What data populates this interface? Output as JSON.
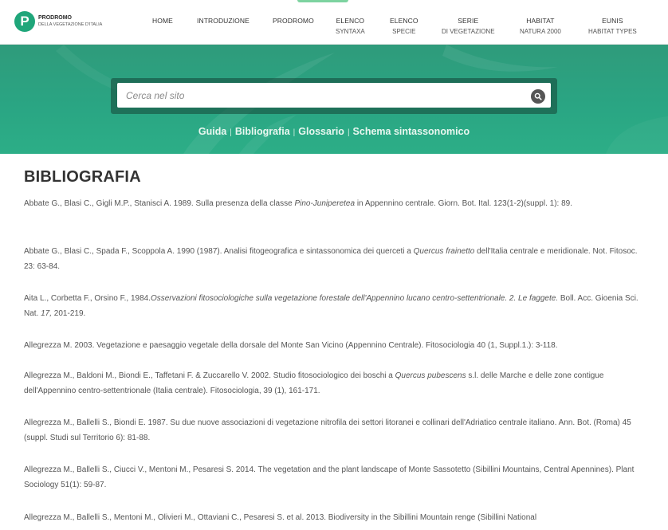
{
  "logo": {
    "letter": "P",
    "title": "PRODROMO",
    "subtitle": "DELLA VEGETAZIONE D'ITALIA"
  },
  "nav": [
    {
      "main": "HOME",
      "sub": ""
    },
    {
      "main": "INTRODUZIONE",
      "sub": ""
    },
    {
      "main": "PRODROMO",
      "sub": ""
    },
    {
      "main": "ELENCO",
      "sub": "SYNTAXA"
    },
    {
      "main": "ELENCO",
      "sub": "SPECIE"
    },
    {
      "main": "SERIE",
      "sub": "DI VEGETAZIONE"
    },
    {
      "main": "HABITAT",
      "sub": "NATURA 2000"
    },
    {
      "main": "EUNIS",
      "sub": "HABITAT TYPES"
    }
  ],
  "search": {
    "placeholder": "Cerca nel sito",
    "value": ""
  },
  "hero_links": [
    "Guida",
    "Bibliografia",
    "Glossario",
    "Schema sintassonomico"
  ],
  "hero_separator": "|",
  "page_title": "BIBLIOGRAFIA",
  "references": [
    [
      {
        "text": "Abbate G., Blasi C., Gigli M.P., Stanisci A. 1989. Sulla presenza della classe "
      },
      {
        "text": "Pino-Juniperetea",
        "italic": true
      },
      {
        "text": " in Appennino centrale. Giorn. Bot. Ital. 123(1-2)(suppl. 1): 89."
      }
    ],
    [
      {
        "text": "Abbate G., Blasi C., Spada F., Scoppola A. 1990 (1987). Analisi fitogeografica e sintassonomica dei querceti a "
      },
      {
        "text": "Quercus frainetto",
        "italic": true
      },
      {
        "text": " dell'Italia centrale e meridionale. Not. Fitosoc. 23: 63-84."
      }
    ],
    [
      {
        "text": "Aita L., Corbetta F., Orsino F., 1984."
      },
      {
        "text": "Osservazioni fitosociologiche sulla vegetazione forestale dell'Appennino lucano centro-settentrionale. 2. Le faggete.",
        "italic": true
      },
      {
        "text": " Boll. Acc. Gioenia Sci. Nat. "
      },
      {
        "text": "17,",
        "italic": true
      },
      {
        "text": " 201-219."
      }
    ],
    [
      {
        "text": "Allegrezza M. 2003. Vegetazione e paesaggio vegetale della dorsale del Monte San Vicino (Appennino Centrale). Fitosociologia 40 (1, Suppl.1.): 3-118."
      }
    ],
    [
      {
        "text": "Allegrezza M., Baldoni M., Biondi E., Taffetani F. & Zuccarello V. 2002. Studio fitosociologico dei boschi a "
      },
      {
        "text": "Quercus pubescens",
        "italic": true
      },
      {
        "text": " s.l. delle Marche e delle zone contigue dell'Appennino centro-settentrionale (Italia centrale). Fitosociologia, 39 (1), 161-171."
      }
    ],
    [
      {
        "text": "Allegrezza M., Ballelli S., Biondi E. 1987. Su due nuove associazioni di vegetazione nitrofila dei settori litoranei e collinari dell'Adriatico centrale italiano. Ann. Bot. (Roma) 45 (suppl. Studi sul Territorio 6): 81-88."
      }
    ],
    [
      {
        "text": "Allegrezza M., Ballelli S., Ciucci V., Mentoni M., Pesaresi S. 2014. The vegetation and the plant landscape of Monte Sassotetto (Sibillini Mountains, Central Apennines). Plant Sociology 51(1): 59-87."
      }
    ],
    [
      {
        "text": "Allegrezza M., Ballelli S., Mentoni M., Olivieri M., Ottaviani C., Pesaresi S. et al. 2013. Biodiversity in the Sibillini Mountain renge (Sibillini National"
      }
    ]
  ]
}
